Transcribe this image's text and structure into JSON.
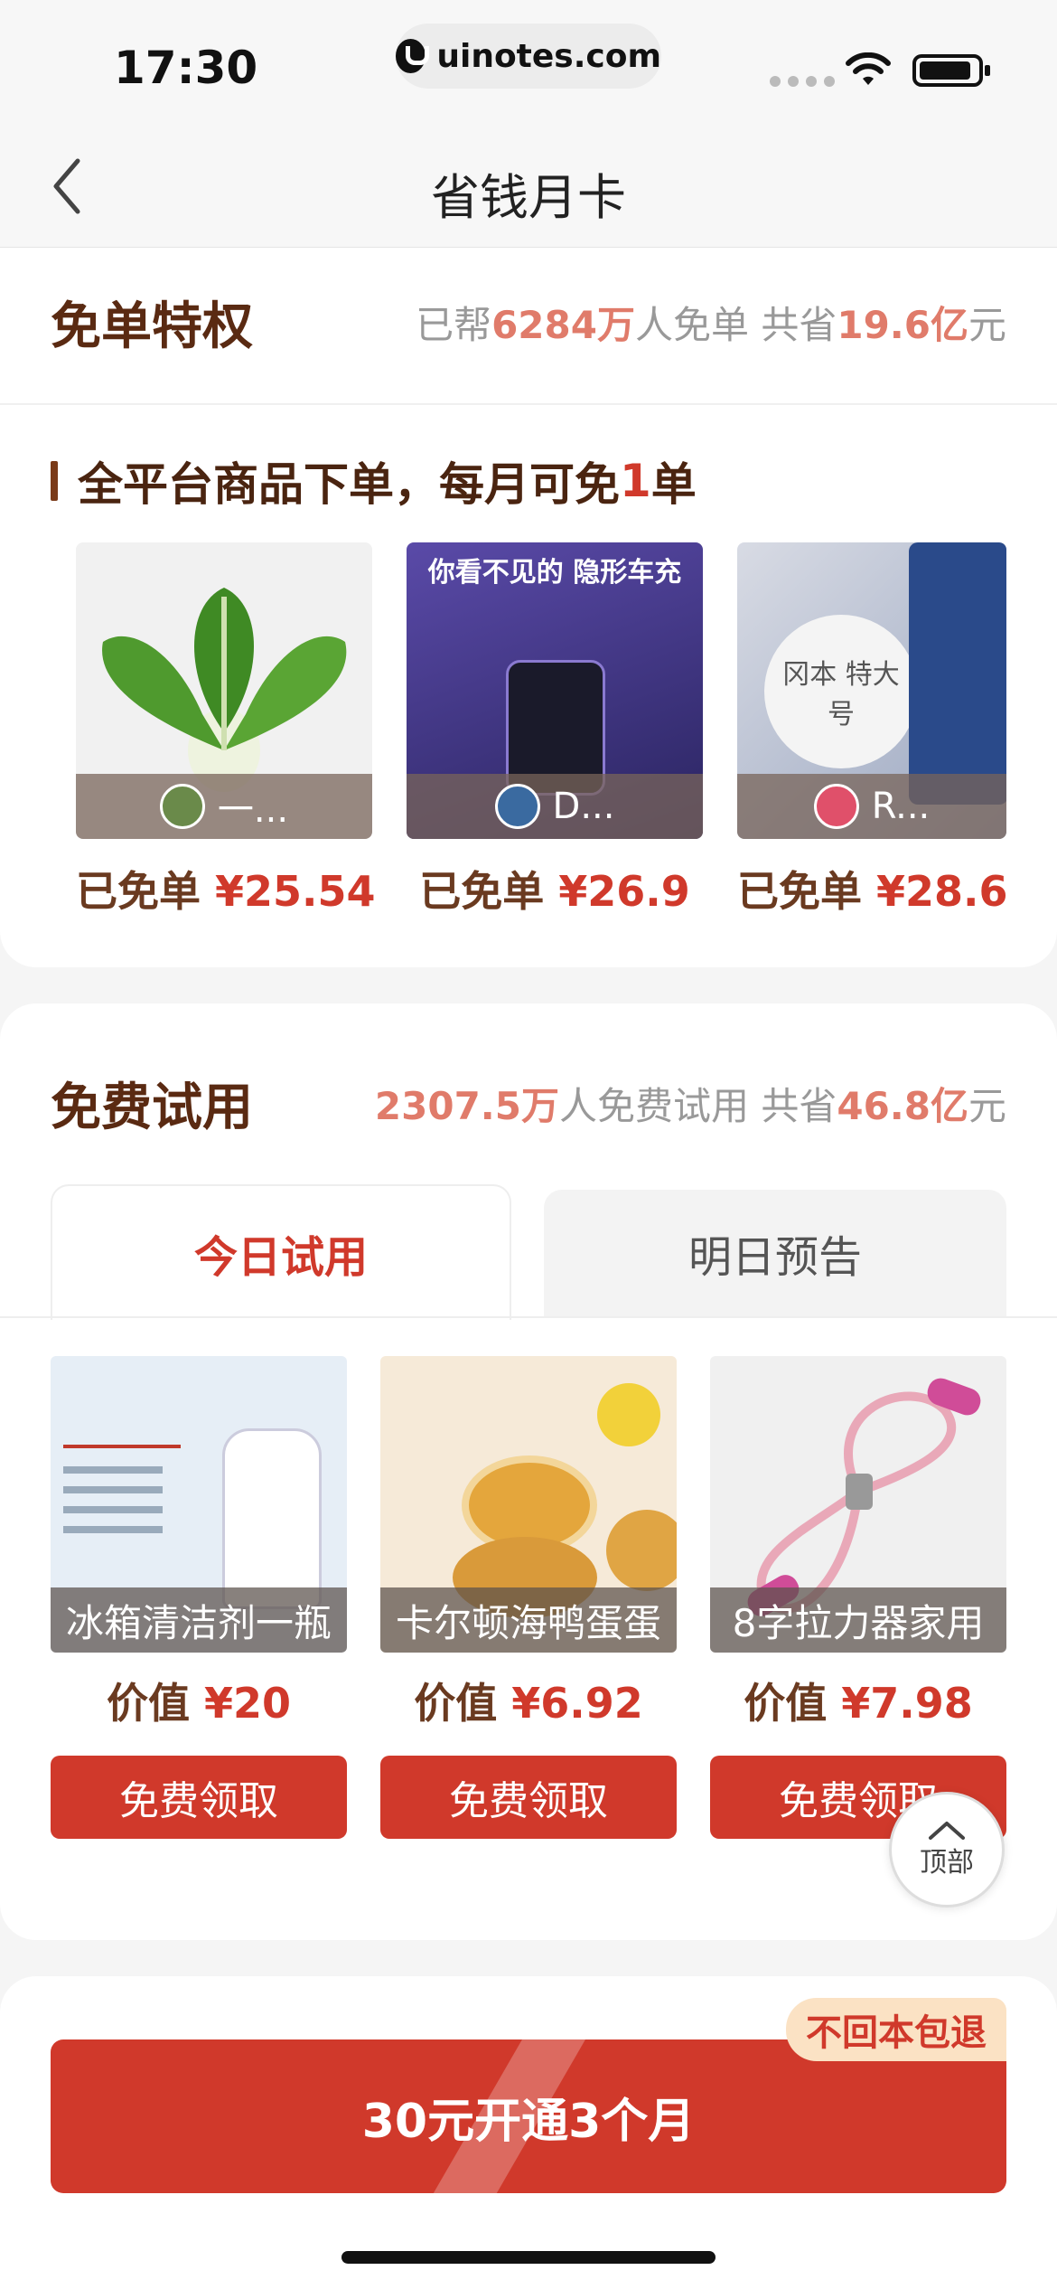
{
  "status_bar": {
    "time": "17:30",
    "url": "uinotes.com"
  },
  "nav": {
    "title": "省钱月卡"
  },
  "free_order": {
    "title": "免单特权",
    "stat": {
      "prefix": "已帮",
      "people": "6284万",
      "mid": "人免单 共省",
      "saved": "19.6亿",
      "suffix": "元"
    },
    "subtitle_prefix": "全平台商品下单，每月可免",
    "subtitle_count": "1",
    "subtitle_suffix": "单",
    "items": [
      {
        "user": "一...",
        "label": "已免单",
        "price": "¥25.54",
        "img_text": ""
      },
      {
        "user": "D...",
        "label": "已免单",
        "price": "¥26.9",
        "img_text": "你看不见的 隐形车充"
      },
      {
        "user": "R...",
        "label": "已免单",
        "price": "¥28.6",
        "img_text": "冈本 特大号"
      }
    ]
  },
  "trial": {
    "title": "免费试用",
    "stat": {
      "people": "2307.5万",
      "mid": "人免费试用 共省",
      "saved": "46.8亿",
      "suffix": "元"
    },
    "tabs": {
      "active": "今日试用",
      "inactive": "明日预告"
    },
    "items": [
      {
        "name": "冰箱清洁剂一瓶",
        "value_label": "价值",
        "price": "¥20",
        "button": "免费领取"
      },
      {
        "name": "卡尔顿海鸭蛋蛋",
        "value_label": "价值",
        "price": "¥6.92",
        "button": "免费领取"
      },
      {
        "name": "8字拉力器家用",
        "value_label": "价值",
        "price": "¥7.98",
        "button": "免费领取"
      }
    ]
  },
  "top_button": {
    "label": "顶部"
  },
  "cta": {
    "label": "30元开通3个月",
    "badge": "不回本包退"
  },
  "colors": {
    "brand_red": "#d0392b",
    "heading_brown": "#5a2a12",
    "highlight": "#e07b6a"
  }
}
